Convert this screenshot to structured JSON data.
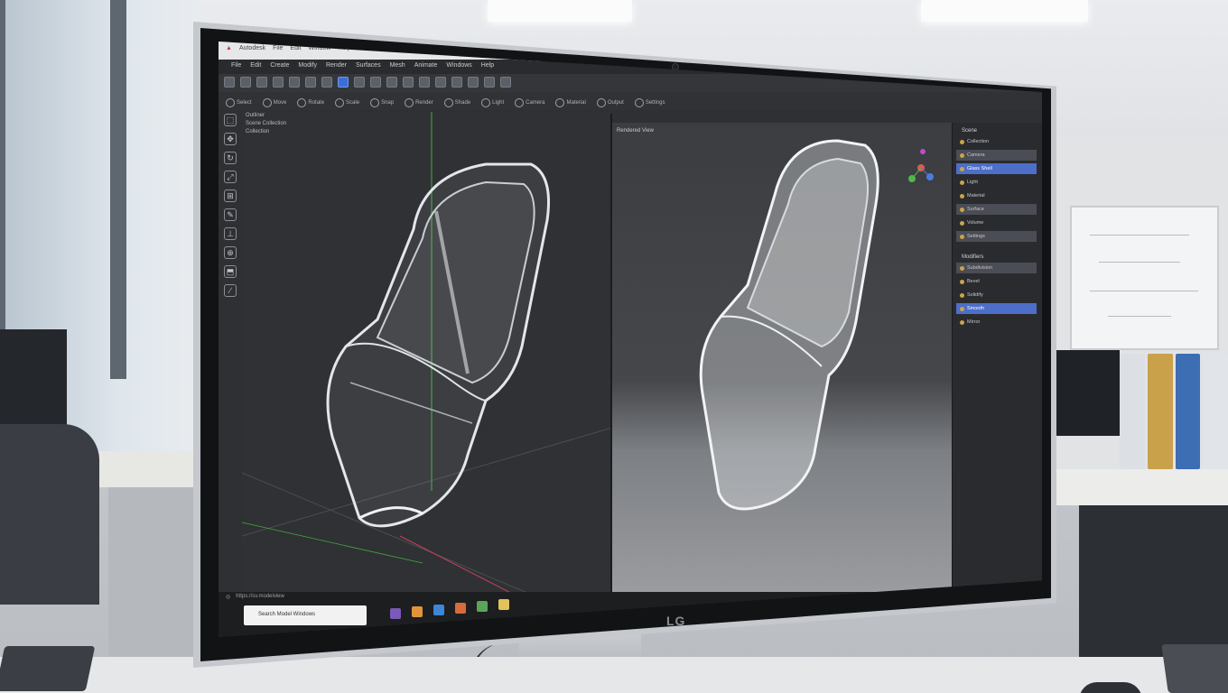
{
  "app": {
    "title_items": [
      "Autodesk",
      "File",
      "Edit",
      "Window",
      "Help"
    ],
    "menu_items": [
      "File",
      "Edit",
      "Create",
      "Modify",
      "Render",
      "Surfaces",
      "Mesh",
      "Animate",
      "Windows",
      "Help"
    ],
    "toolbar2_items": [
      "Select",
      "Move",
      "Rotate",
      "Scale",
      "Snap",
      "Render",
      "Shade",
      "Light",
      "Camera",
      "Material",
      "Output",
      "Settings"
    ],
    "outliner_lines": [
      "Outliner",
      "Scene Collection",
      "Collection"
    ],
    "left_tools": [
      "select-tool-icon",
      "move-tool-icon",
      "rotate-tool-icon",
      "scale-tool-icon",
      "transform-tool-icon",
      "annotate-tool-icon",
      "measure-tool-icon",
      "cursor-tool-icon",
      "extrude-tool-icon",
      "knife-tool-icon"
    ]
  },
  "viewport_right": {
    "header": "Rendered View"
  },
  "properties": {
    "header": "Scene",
    "rows": [
      {
        "label": "Collection",
        "state": "normal"
      },
      {
        "label": "Camera",
        "state": "hl"
      },
      {
        "label": "Glass Shell",
        "state": "sel"
      },
      {
        "label": "Light",
        "state": "normal"
      },
      {
        "label": "Material",
        "state": "normal"
      },
      {
        "label": "Surface",
        "state": "hl"
      },
      {
        "label": "Volume",
        "state": "normal"
      },
      {
        "label": "Settings",
        "state": "hl"
      }
    ],
    "section2_header": "Modifiers",
    "rows2": [
      {
        "label": "Subdivision",
        "state": "hl"
      },
      {
        "label": "Bevel",
        "state": "normal"
      },
      {
        "label": "Solidify",
        "state": "normal"
      },
      {
        "label": "Smooth",
        "state": "sel"
      },
      {
        "label": "Mirror",
        "state": "normal"
      }
    ]
  },
  "taskbar": {
    "search_placeholder": "Search Model Windows",
    "status_text": "https://sv.modelview"
  },
  "colors": {
    "accent": "#3c6fd6",
    "selected_row": "#4d6ec9",
    "viewport_bg": "#303134"
  }
}
